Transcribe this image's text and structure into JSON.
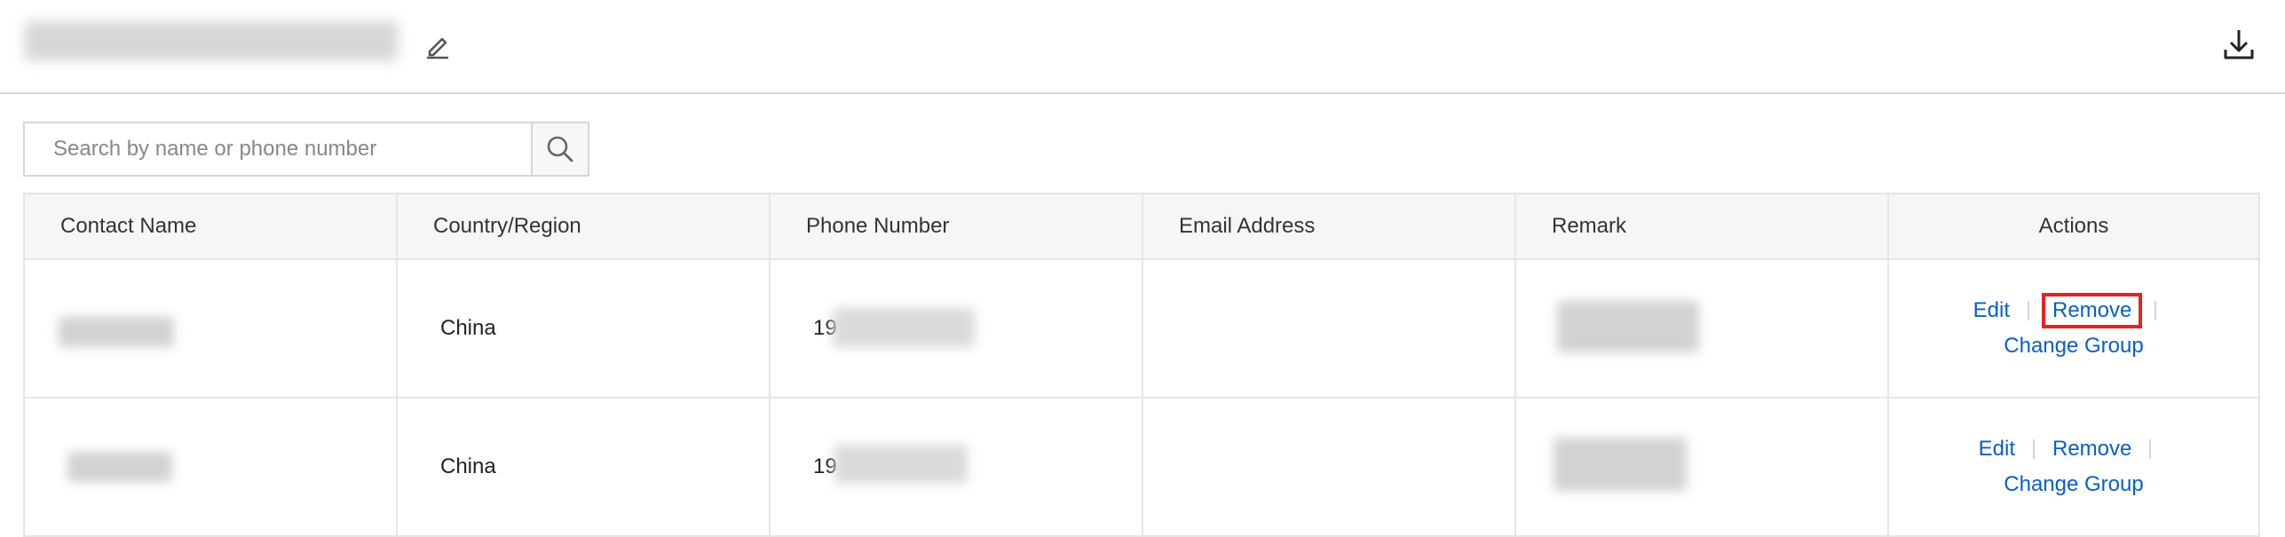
{
  "header": {
    "edit_icon": "pencil-edit-icon",
    "download_icon": "download-icon"
  },
  "search": {
    "placeholder": "Search by name or phone number",
    "button_icon": "search-icon"
  },
  "table": {
    "columns": [
      "Contact Name",
      "Country/Region",
      "Phone Number",
      "Email Address",
      "Remark",
      "Actions"
    ],
    "rows": [
      {
        "country": "China",
        "phone_prefix": "19",
        "actions": {
          "edit": "Edit",
          "remove": "Remove",
          "change_group": "Change Group"
        }
      },
      {
        "country": "China",
        "phone_prefix": "19",
        "actions": {
          "edit": "Edit",
          "remove": "Remove",
          "change_group": "Change Group"
        }
      }
    ]
  },
  "colors": {
    "link": "#0a5fc7",
    "highlight": "#e8231b",
    "header_bg": "#f6f6f6"
  }
}
